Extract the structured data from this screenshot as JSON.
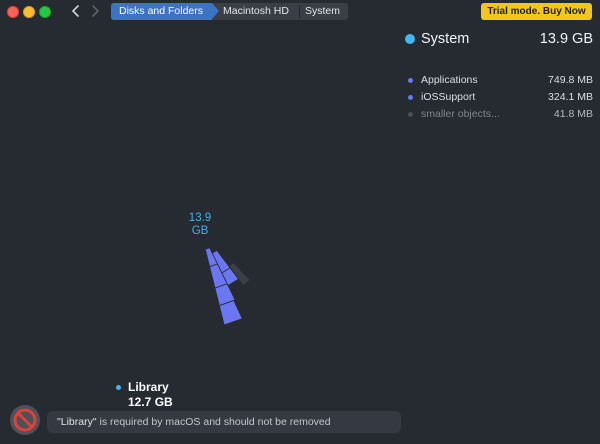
{
  "titlebar": {
    "breadcrumbs": [
      "Disks and Folders",
      "Macintosh HD",
      "System"
    ],
    "trial_button_label": "Trial mode. Buy Now"
  },
  "summary": {
    "name": "System",
    "size": "13.9 GB",
    "dot_color": "#40b8f0"
  },
  "items": [
    {
      "name": "Applications",
      "size": "749.8  MB",
      "color": "#6a77f0"
    },
    {
      "name": "iOSSupport",
      "size": "324.1  MB",
      "color": "#6a77f0"
    },
    {
      "name": "smaller objects...",
      "size": "41.8  MB",
      "color": "#4a4e56"
    }
  ],
  "chart": {
    "center_value": "13.9",
    "center_unit": "GB",
    "segment_color": "#6a77f0",
    "small_segment_color": "#3b3f47"
  },
  "hovered": {
    "name": "Library",
    "size": "12.7 GB"
  },
  "warning": {
    "quoted": "\"Library\"",
    "text": " is required by macOS and should not be removed"
  },
  "icons": {
    "back": "chevron-left-icon",
    "forward": "chevron-right-icon",
    "prohibited": "no-entry-icon"
  }
}
